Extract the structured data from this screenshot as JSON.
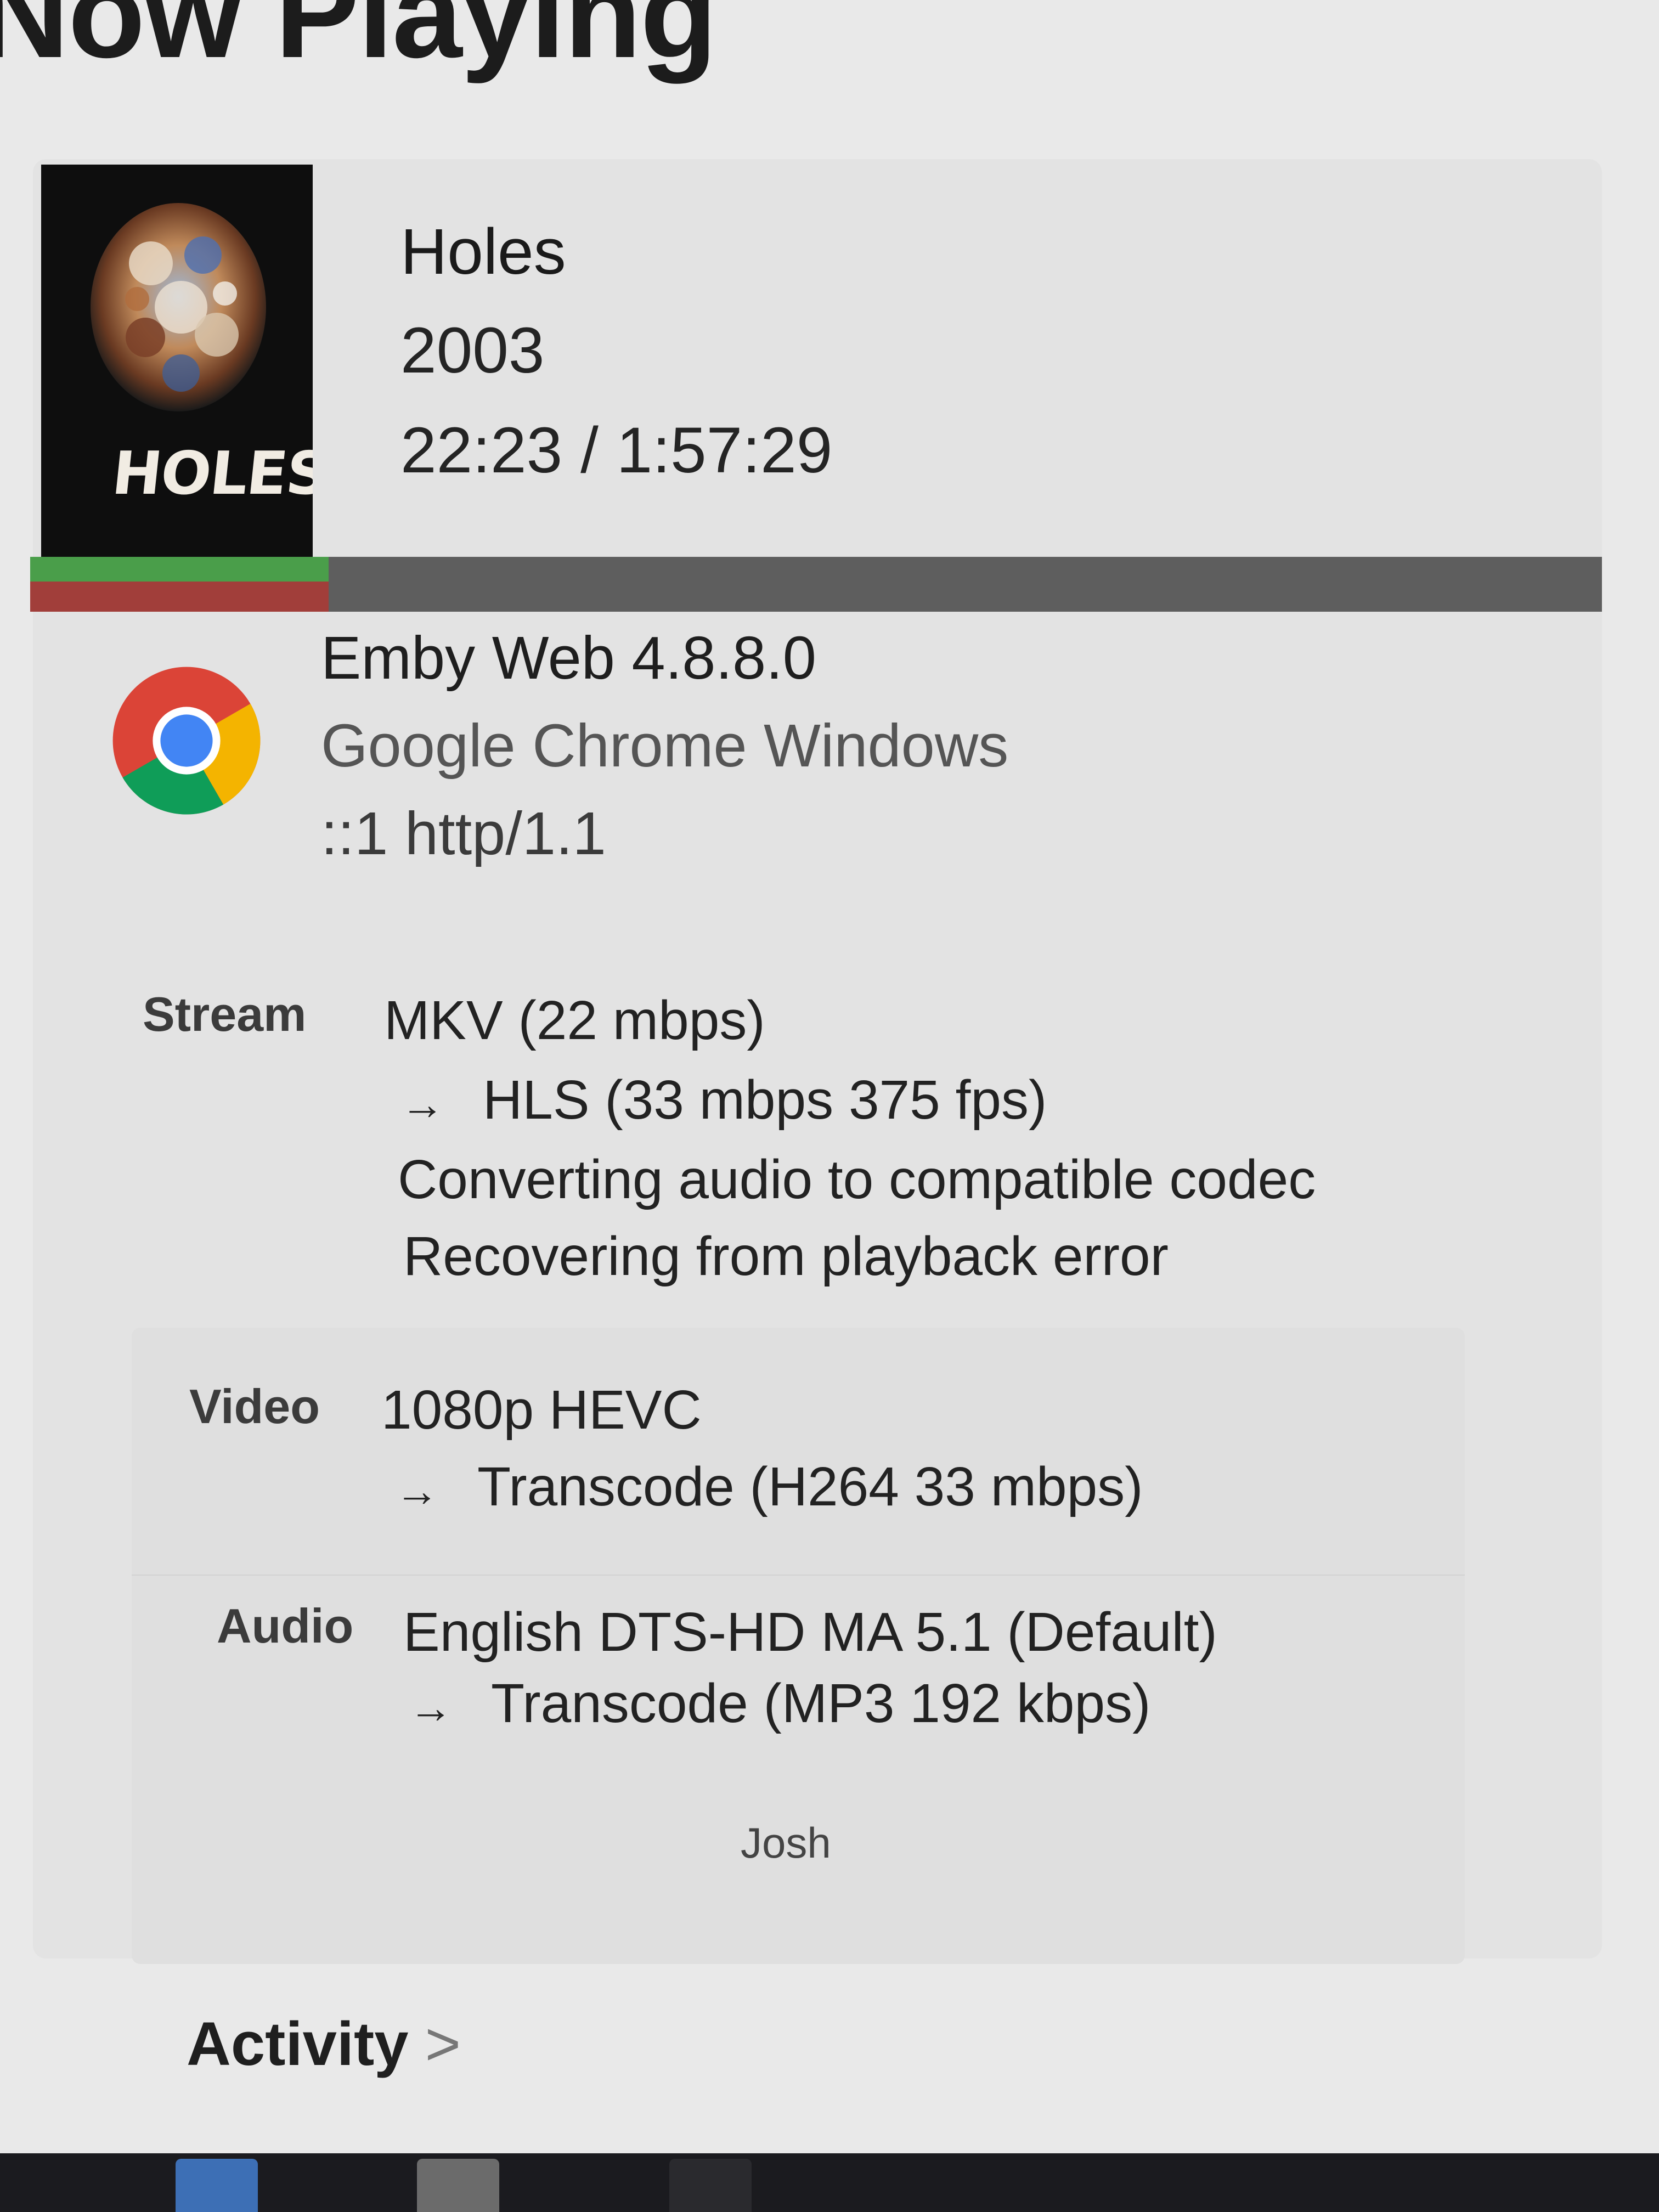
{
  "header": {
    "title": "Now Playing"
  },
  "now_playing": {
    "poster": {
      "logo_text": "HOLES"
    },
    "title": "Holes",
    "year": "2003",
    "position": "22:23 / 1:57:29",
    "progress_fraction": 0.19,
    "client": {
      "icon": "chrome-icon",
      "app": "Emby Web 4.8.8.0",
      "device": "Google Chrome Windows",
      "address": "::1 http/1.1"
    },
    "stream": {
      "label": "Stream",
      "source": "MKV (22 mbps)",
      "arrow": "→",
      "target": "HLS (33 mbps 375 fps)",
      "reasons": [
        "Converting audio to compatible codec",
        "Recovering from playback error"
      ]
    },
    "video": {
      "label": "Video",
      "source": "1080p HEVC",
      "arrow": "→",
      "target": "Transcode (H264 33 mbps)"
    },
    "audio": {
      "label": "Audio",
      "source": "English DTS-HD MA 5.1 (Default)",
      "arrow": "→",
      "target": "Transcode (MP3 192 kbps)"
    },
    "user": "Josh"
  },
  "activity": {
    "label": "Activity",
    "chevron": ">"
  },
  "colors": {
    "progress_played": "#a13e3a",
    "progress_buffered": "#4a9e4a",
    "progress_track": "#5e5e5e"
  }
}
